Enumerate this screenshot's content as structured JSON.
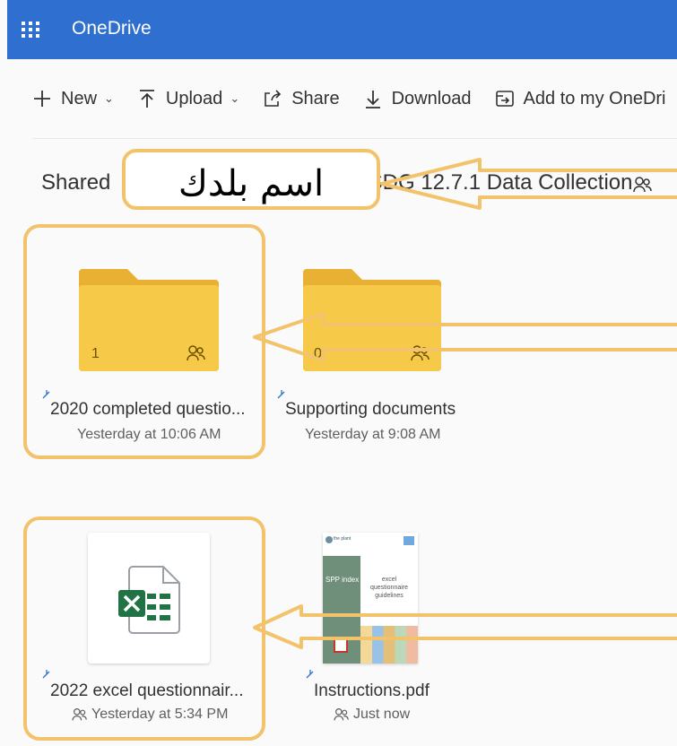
{
  "app": {
    "title": "OneDrive"
  },
  "toolbar": {
    "new_label": "New",
    "upload_label": "Upload",
    "share_label": "Share",
    "download_label": "Download",
    "add_label": "Add to my OneDri"
  },
  "breadcrumb": {
    "root": "Shared",
    "separator": ">",
    "title": "- SDG 12.7.1 Data Collection"
  },
  "overlay": {
    "country_label": "اسم بلدك"
  },
  "items": [
    {
      "name": "2020 completed questio...",
      "date": "Yesterday at 10:06 AM",
      "count": "1",
      "type": "folder"
    },
    {
      "name": "Supporting documents",
      "date": "Yesterday at 9:08 AM",
      "count": "0",
      "type": "folder"
    },
    {
      "name": "2022 excel questionnair...",
      "date": "Yesterday at 5:34 PM",
      "type": "excel"
    },
    {
      "name": "Instructions.pdf",
      "date": "Just now",
      "type": "pdf"
    }
  ],
  "pdf_thumb": {
    "brand": "the plant",
    "side_title": "SPP index",
    "body_title": "excel questionnaire guidelines"
  },
  "colors": {
    "header": "#2f6fd0",
    "highlight": "#f3c36b",
    "folder": "#f7c948",
    "excel": "#217346"
  }
}
